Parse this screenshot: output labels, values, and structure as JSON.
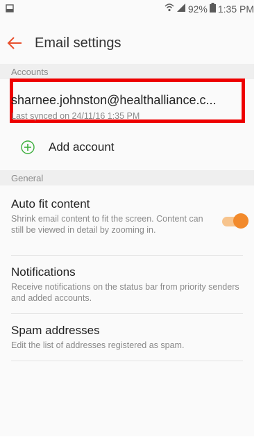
{
  "status_bar": {
    "left_icon": "screenshot-icon",
    "battery": "92%",
    "time": "1:35 PM"
  },
  "header": {
    "title": "Email settings"
  },
  "accounts": {
    "section_label": "Accounts",
    "email": "sharnee.johnston@healthalliance.c...",
    "last_synced": "Last synced on 24/11/16  1:35 PM",
    "add_label": "Add account"
  },
  "general": {
    "section_label": "General",
    "auto_fit": {
      "title": "Auto fit content",
      "description": "Shrink email content to fit the screen. Content can still be viewed in detail by zooming in.",
      "enabled": true
    },
    "notifications": {
      "title": "Notifications",
      "description": "Receive notifications on the status bar from priority senders and added accounts."
    },
    "spam": {
      "title": "Spam addresses",
      "description": "Edit the list of addresses registered as spam."
    }
  },
  "colors": {
    "accent": "#f28a2c",
    "back_arrow": "#e8512e",
    "highlight_box": "#ee0000",
    "plus_icon": "#3cae3c"
  }
}
